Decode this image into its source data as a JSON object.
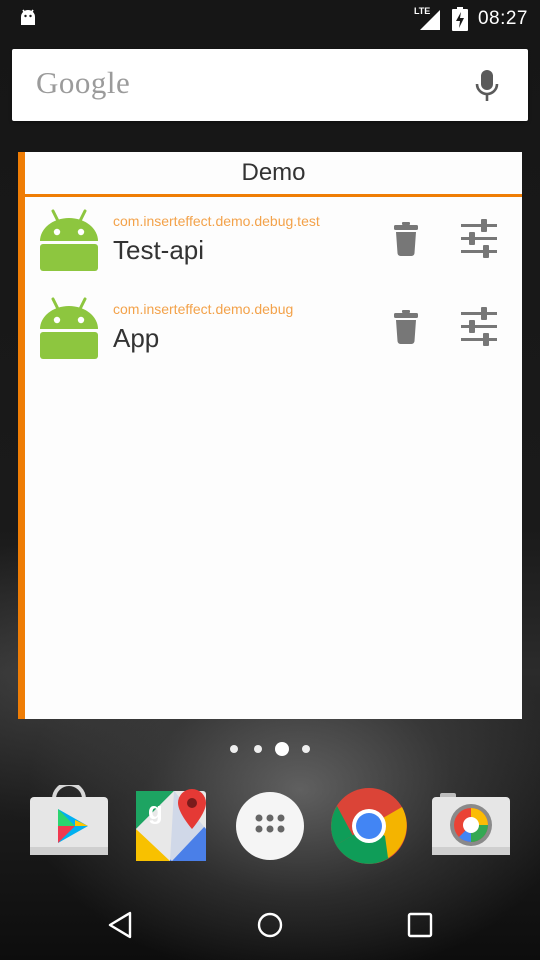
{
  "status_bar": {
    "network": "LTE",
    "time": "08:27"
  },
  "search": {
    "logo_text": "Google",
    "icons": {
      "mic": "mic-icon"
    }
  },
  "widget": {
    "title": "Demo",
    "accent_color": "#ef7d05",
    "apps": [
      {
        "package": "com.inserteffect.demo.debug.test",
        "name": "Test-api",
        "icon": "android-robot-icon"
      },
      {
        "package": "com.inserteffect.demo.debug",
        "name": "App",
        "icon": "android-robot-icon"
      }
    ],
    "actions": {
      "delete": "trash-icon",
      "settings": "sliders-icon"
    }
  },
  "home": {
    "page_count": 4,
    "active_page": 3
  },
  "dock": [
    "play-store-icon",
    "maps-icon",
    "app-drawer-icon",
    "chrome-icon",
    "camera-icon"
  ],
  "nav": [
    "back-icon",
    "home-icon",
    "recents-icon"
  ]
}
